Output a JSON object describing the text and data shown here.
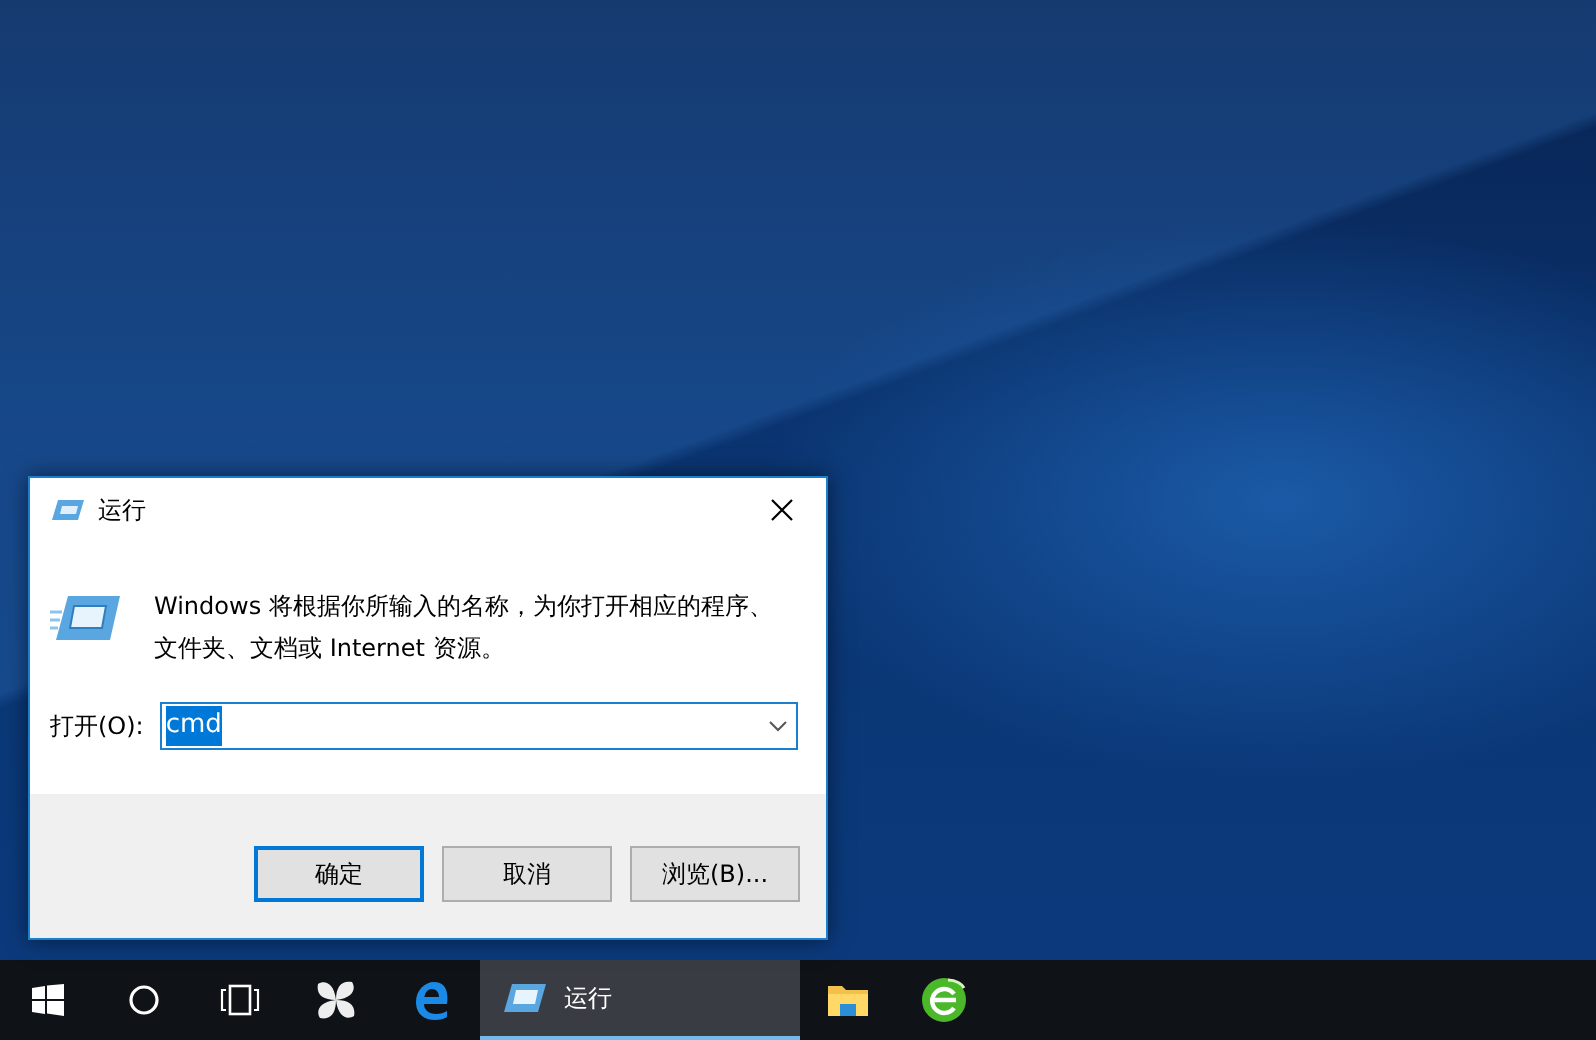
{
  "dialog": {
    "title": "运行",
    "message": "Windows 将根据你所输入的名称，为你打开相应的程序、文件夹、文档或 Internet 资源。",
    "open_label": "打开(O):",
    "command": {
      "value": "cmd",
      "text_selected": true
    },
    "buttons": [
      {
        "label": "确定",
        "default": true
      },
      {
        "label": "取消",
        "default": false
      },
      {
        "label": "浏览(B)...",
        "default": false
      }
    ]
  },
  "taskbar": {
    "items": [
      {
        "kind": "start"
      },
      {
        "kind": "cortana"
      },
      {
        "kind": "task_view"
      },
      {
        "kind": "pinwheel"
      },
      {
        "kind": "edge"
      },
      {
        "kind": "window",
        "label": "运行",
        "active": true
      },
      {
        "kind": "explorer"
      },
      {
        "kind": "browser"
      }
    ]
  }
}
